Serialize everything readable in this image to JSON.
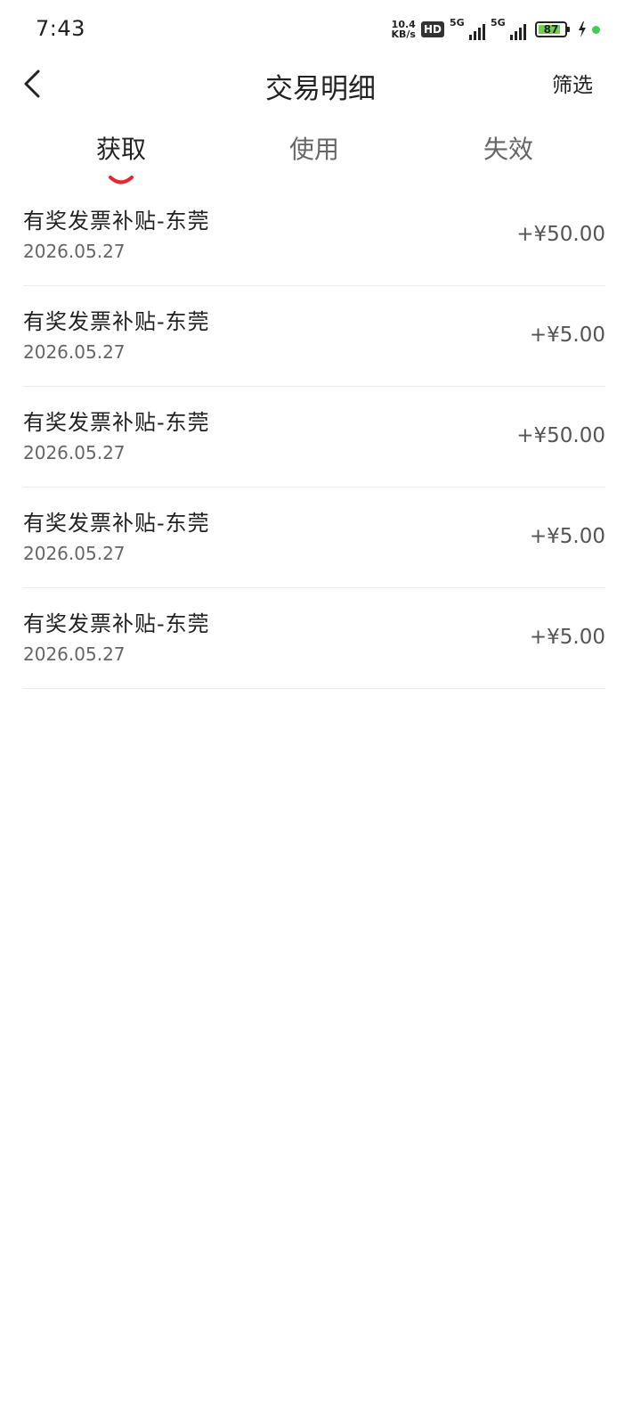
{
  "status_bar": {
    "time": "7:43",
    "net_speed_value": "10.4",
    "net_speed_unit": "KB/s",
    "hd_label": "HD",
    "signal1_label": "5G",
    "signal2_label": "5G",
    "battery_level": "87",
    "battery_fraction": 0.87,
    "battery_color": "#6fd349",
    "dot_color": "#3ecf52"
  },
  "nav": {
    "back_icon": "chevron-left-icon",
    "title": "交易明细",
    "filter_label": "筛选"
  },
  "tabs": [
    {
      "label": "获取",
      "active": true
    },
    {
      "label": "使用",
      "active": false
    },
    {
      "label": "失效",
      "active": false
    }
  ],
  "accent_color": "#e8272d",
  "transactions": [
    {
      "title": "有奖发票补贴-东莞",
      "date": "2026.05.27",
      "amount": "+¥50.00"
    },
    {
      "title": "有奖发票补贴-东莞",
      "date": "2026.05.27",
      "amount": "+¥5.00"
    },
    {
      "title": "有奖发票补贴-东莞",
      "date": "2026.05.27",
      "amount": "+¥50.00"
    },
    {
      "title": "有奖发票补贴-东莞",
      "date": "2026.05.27",
      "amount": "+¥5.00"
    },
    {
      "title": "有奖发票补贴-东莞",
      "date": "2026.05.27",
      "amount": "+¥5.00"
    }
  ]
}
